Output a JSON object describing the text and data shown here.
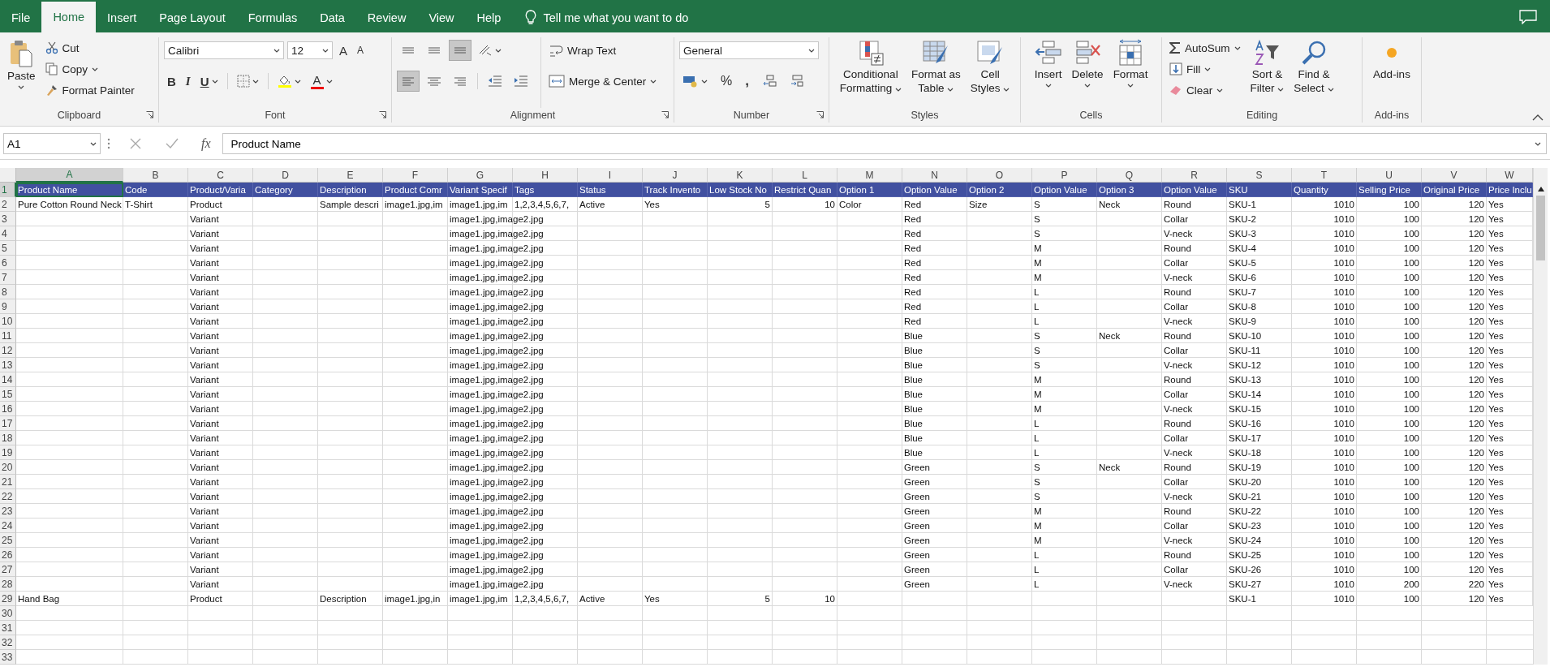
{
  "tabs": [
    {
      "label": "File",
      "selected": false
    },
    {
      "label": "Home",
      "selected": true
    },
    {
      "label": "Insert",
      "selected": false
    },
    {
      "label": "Page Layout",
      "selected": false
    },
    {
      "label": "Formulas",
      "selected": false
    },
    {
      "label": "Data",
      "selected": false
    },
    {
      "label": "Review",
      "selected": false
    },
    {
      "label": "View",
      "selected": false
    },
    {
      "label": "Help",
      "selected": false
    }
  ],
  "tell_me": "Tell me what you want to do",
  "ribbon": {
    "clipboard": {
      "label": "Clipboard",
      "paste": "Paste",
      "cut": "Cut",
      "copy": "Copy",
      "format_painter": "Format Painter"
    },
    "font": {
      "label": "Font",
      "name": "Calibri",
      "size": "12",
      "grow": "A",
      "shrink": "A",
      "bold": "B",
      "italic": "I",
      "underline": "U",
      "font_color": "A"
    },
    "alignment": {
      "label": "Alignment",
      "buttons": [
        {
          "kind": "top",
          "pressed": false
        },
        {
          "kind": "middle",
          "pressed": false
        },
        {
          "kind": "bottom",
          "pressed": true
        },
        {
          "kind": "left",
          "pressed": true
        },
        {
          "kind": "center",
          "pressed": false
        },
        {
          "kind": "right",
          "pressed": false
        }
      ],
      "wrap_text": "Wrap Text",
      "merge": "Merge & Center"
    },
    "number": {
      "label": "Number",
      "format": "General",
      "percent": "%",
      "comma": ","
    },
    "styles": {
      "label": "Styles",
      "buttons": [
        {
          "kind": "conditional",
          "lines": [
            "Conditional",
            "Formatting"
          ]
        },
        {
          "kind": "table",
          "lines": [
            "Format as",
            "Table"
          ]
        },
        {
          "kind": "cell",
          "lines": [
            "Cell",
            "Styles"
          ]
        }
      ]
    },
    "cells": {
      "label": "Cells",
      "buttons": [
        {
          "kind": "insert",
          "label": "Insert"
        },
        {
          "kind": "delete",
          "label": "Delete"
        },
        {
          "kind": "format",
          "label": "Format"
        }
      ]
    },
    "editing": {
      "label": "Editing",
      "autosum": "AutoSum",
      "fill": "Fill",
      "clear": "Clear",
      "sort": [
        "Sort &",
        "Filter"
      ],
      "find": [
        "Find &",
        "Select"
      ]
    },
    "addins": {
      "label": "Add-ins",
      "button": "Add-ins"
    }
  },
  "formula_bar": {
    "name_box": "A1",
    "fx": "fx",
    "value": "Product Name"
  },
  "columns": [
    {
      "letter": "A",
      "kind": "text",
      "selected": true
    },
    {
      "letter": "B",
      "kind": "text",
      "selected": false
    },
    {
      "letter": "C",
      "kind": "text",
      "selected": false
    },
    {
      "letter": "D",
      "selected": false
    },
    {
      "letter": "E",
      "kind": "text",
      "selected": false
    },
    {
      "letter": "F",
      "kind": "text",
      "selected": false
    },
    {
      "letter": "G",
      "kind": "text",
      "selected": false
    },
    {
      "letter": "H",
      "kind": "text",
      "selected": false
    },
    {
      "letter": "I",
      "kind": "text",
      "selected": false
    },
    {
      "letter": "J",
      "kind": "text",
      "selected": false
    },
    {
      "letter": "K",
      "kind": "number",
      "selected": false
    },
    {
      "letter": "L",
      "kind": "number",
      "selected": false
    },
    {
      "letter": "M",
      "kind": "text",
      "selected": false
    },
    {
      "letter": "N",
      "kind": "text",
      "selected": false
    },
    {
      "letter": "O",
      "kind": "text",
      "selected": false
    },
    {
      "letter": "P",
      "kind": "text",
      "selected": false
    },
    {
      "letter": "Q",
      "kind": "text",
      "selected": false
    },
    {
      "letter": "R",
      "kind": "text",
      "selected": false
    },
    {
      "letter": "S",
      "kind": "text",
      "selected": false
    },
    {
      "letter": "T",
      "kind": "number",
      "selected": false
    },
    {
      "letter": "U",
      "kind": "number",
      "selected": false
    },
    {
      "letter": "V",
      "kind": "number",
      "selected": false
    },
    {
      "letter": "W",
      "kind": "text",
      "selected": false
    }
  ],
  "header_row": {
    "n": "1",
    "selected": true,
    "cells": [
      "Product Name",
      "Code",
      "Product/Varia",
      "Category",
      "Description",
      "Product Comr",
      "Variant Specif",
      "Tags",
      "Status",
      "Track Invento",
      "Low Stock No",
      "Restrict Quan",
      "Option 1",
      "Option Value",
      "Option 2",
      "Option Value",
      "Option 3",
      "Option Value",
      "SKU",
      "Quantity",
      "Selling Price",
      "Original Price",
      "Price Inclu"
    ]
  },
  "rows": [
    {
      "n": "2",
      "selected": false,
      "cells": {
        "A": "Pure Cotton Round Neck",
        "B": "T-Shirt",
        "C": "Product",
        "E": "Sample descri",
        "F": "image1.jpg,im",
        "G": "image1.jpg,im",
        "H": "1,2,3,4,5,6,7,",
        "I": "Active",
        "J": "Yes",
        "K": "5",
        "L": "10",
        "M": "Color",
        "N": "Red",
        "O": "Size",
        "P": "S",
        "Q": "Neck",
        "R": "Round",
        "S": "SKU-1",
        "T": "1010",
        "U": "100",
        "V": "120",
        "W": "Yes"
      }
    },
    {
      "n": "3",
      "selected": false,
      "cells": {
        "C": "Variant",
        "G": "image1.jpg,image2.jpg",
        "N": "Red",
        "P": "S",
        "R": "Collar",
        "S": "SKU-2",
        "T": "1010",
        "U": "100",
        "V": "120",
        "W": "Yes"
      }
    },
    {
      "n": "4",
      "selected": false,
      "cells": {
        "C": "Variant",
        "G": "image1.jpg,image2.jpg",
        "N": "Red",
        "P": "S",
        "R": "V-neck",
        "S": "SKU-3",
        "T": "1010",
        "U": "100",
        "V": "120",
        "W": "Yes"
      }
    },
    {
      "n": "5",
      "selected": false,
      "cells": {
        "C": "Variant",
        "G": "image1.jpg,image2.jpg",
        "N": "Red",
        "P": "M",
        "R": "Round",
        "S": "SKU-4",
        "T": "1010",
        "U": "100",
        "V": "120",
        "W": "Yes"
      }
    },
    {
      "n": "6",
      "selected": false,
      "cells": {
        "C": "Variant",
        "G": "image1.jpg,image2.jpg",
        "N": "Red",
        "P": "M",
        "R": "Collar",
        "S": "SKU-5",
        "T": "1010",
        "U": "100",
        "V": "120",
        "W": "Yes"
      }
    },
    {
      "n": "7",
      "selected": false,
      "cells": {
        "C": "Variant",
        "G": "image1.jpg,image2.jpg",
        "N": "Red",
        "P": "M",
        "R": "V-neck",
        "S": "SKU-6",
        "T": "1010",
        "U": "100",
        "V": "120",
        "W": "Yes"
      }
    },
    {
      "n": "8",
      "selected": false,
      "cells": {
        "C": "Variant",
        "G": "image1.jpg,image2.jpg",
        "N": "Red",
        "P": "L",
        "R": "Round",
        "S": "SKU-7",
        "T": "1010",
        "U": "100",
        "V": "120",
        "W": "Yes"
      }
    },
    {
      "n": "9",
      "selected": false,
      "cells": {
        "C": "Variant",
        "G": "image1.jpg,image2.jpg",
        "N": "Red",
        "P": "L",
        "R": "Collar",
        "S": "SKU-8",
        "T": "1010",
        "U": "100",
        "V": "120",
        "W": "Yes"
      }
    },
    {
      "n": "10",
      "selected": false,
      "cells": {
        "C": "Variant",
        "G": "image1.jpg,image2.jpg",
        "N": "Red",
        "P": "L",
        "R": "V-neck",
        "S": "SKU-9",
        "T": "1010",
        "U": "100",
        "V": "120",
        "W": "Yes"
      }
    },
    {
      "n": "11",
      "selected": false,
      "cells": {
        "C": "Variant",
        "G": "image1.jpg,image2.jpg",
        "N": "Blue",
        "P": "S",
        "Q": "Neck",
        "R": "Round",
        "S": "SKU-10",
        "T": "1010",
        "U": "100",
        "V": "120",
        "W": "Yes"
      }
    },
    {
      "n": "12",
      "selected": false,
      "cells": {
        "C": "Variant",
        "G": "image1.jpg,image2.jpg",
        "N": "Blue",
        "P": "S",
        "R": "Collar",
        "S": "SKU-11",
        "T": "1010",
        "U": "100",
        "V": "120",
        "W": "Yes"
      }
    },
    {
      "n": "13",
      "selected": false,
      "cells": {
        "C": "Variant",
        "G": "image1.jpg,image2.jpg",
        "N": "Blue",
        "P": "S",
        "R": "V-neck",
        "S": "SKU-12",
        "T": "1010",
        "U": "100",
        "V": "120",
        "W": "Yes"
      }
    },
    {
      "n": "14",
      "selected": false,
      "cells": {
        "C": "Variant",
        "G": "image1.jpg,image2.jpg",
        "N": "Blue",
        "P": "M",
        "R": "Round",
        "S": "SKU-13",
        "T": "1010",
        "U": "100",
        "V": "120",
        "W": "Yes"
      }
    },
    {
      "n": "15",
      "selected": false,
      "cells": {
        "C": "Variant",
        "G": "image1.jpg,image2.jpg",
        "N": "Blue",
        "P": "M",
        "R": "Collar",
        "S": "SKU-14",
        "T": "1010",
        "U": "100",
        "V": "120",
        "W": "Yes"
      }
    },
    {
      "n": "16",
      "selected": false,
      "cells": {
        "C": "Variant",
        "G": "image1.jpg,image2.jpg",
        "N": "Blue",
        "P": "M",
        "R": "V-neck",
        "S": "SKU-15",
        "T": "1010",
        "U": "100",
        "V": "120",
        "W": "Yes"
      }
    },
    {
      "n": "17",
      "selected": false,
      "cells": {
        "C": "Variant",
        "G": "image1.jpg,image2.jpg",
        "N": "Blue",
        "P": "L",
        "R": "Round",
        "S": "SKU-16",
        "T": "1010",
        "U": "100",
        "V": "120",
        "W": "Yes"
      }
    },
    {
      "n": "18",
      "selected": false,
      "cells": {
        "C": "Variant",
        "G": "image1.jpg,image2.jpg",
        "N": "Blue",
        "P": "L",
        "R": "Collar",
        "S": "SKU-17",
        "T": "1010",
        "U": "100",
        "V": "120",
        "W": "Yes"
      }
    },
    {
      "n": "19",
      "selected": false,
      "cells": {
        "C": "Variant",
        "G": "image1.jpg,image2.jpg",
        "N": "Blue",
        "P": "L",
        "R": "V-neck",
        "S": "SKU-18",
        "T": "1010",
        "U": "100",
        "V": "120",
        "W": "Yes"
      }
    },
    {
      "n": "20",
      "selected": false,
      "cells": {
        "C": "Variant",
        "G": "image1.jpg,image2.jpg",
        "N": "Green",
        "P": "S",
        "Q": "Neck",
        "R": "Round",
        "S": "SKU-19",
        "T": "1010",
        "U": "100",
        "V": "120",
        "W": "Yes"
      }
    },
    {
      "n": "21",
      "selected": false,
      "cells": {
        "C": "Variant",
        "G": "image1.jpg,image2.jpg",
        "N": "Green",
        "P": "S",
        "R": "Collar",
        "S": "SKU-20",
        "T": "1010",
        "U": "100",
        "V": "120",
        "W": "Yes"
      }
    },
    {
      "n": "22",
      "selected": false,
      "cells": {
        "C": "Variant",
        "G": "image1.jpg,image2.jpg",
        "N": "Green",
        "P": "S",
        "R": "V-neck",
        "S": "SKU-21",
        "T": "1010",
        "U": "100",
        "V": "120",
        "W": "Yes"
      }
    },
    {
      "n": "23",
      "selected": false,
      "cells": {
        "C": "Variant",
        "G": "image1.jpg,image2.jpg",
        "N": "Green",
        "P": "M",
        "R": "Round",
        "S": "SKU-22",
        "T": "1010",
        "U": "100",
        "V": "120",
        "W": "Yes"
      }
    },
    {
      "n": "24",
      "selected": false,
      "cells": {
        "C": "Variant",
        "G": "image1.jpg,image2.jpg",
        "N": "Green",
        "P": "M",
        "R": "Collar",
        "S": "SKU-23",
        "T": "1010",
        "U": "100",
        "V": "120",
        "W": "Yes"
      }
    },
    {
      "n": "25",
      "selected": false,
      "cells": {
        "C": "Variant",
        "G": "image1.jpg,image2.jpg",
        "N": "Green",
        "P": "M",
        "R": "V-neck",
        "S": "SKU-24",
        "T": "1010",
        "U": "100",
        "V": "120",
        "W": "Yes"
      }
    },
    {
      "n": "26",
      "selected": false,
      "cells": {
        "C": "Variant",
        "G": "image1.jpg,image2.jpg",
        "N": "Green",
        "P": "L",
        "R": "Round",
        "S": "SKU-25",
        "T": "1010",
        "U": "100",
        "V": "120",
        "W": "Yes"
      }
    },
    {
      "n": "27",
      "selected": false,
      "cells": {
        "C": "Variant",
        "G": "image1.jpg,image2.jpg",
        "N": "Green",
        "P": "L",
        "R": "Collar",
        "S": "SKU-26",
        "T": "1010",
        "U": "100",
        "V": "120",
        "W": "Yes"
      }
    },
    {
      "n": "28",
      "selected": false,
      "cells": {
        "C": "Variant",
        "G": "image1.jpg,image2.jpg",
        "N": "Green",
        "P": "L",
        "R": "V-neck",
        "S": "SKU-27",
        "T": "1010",
        "U": "200",
        "V": "220",
        "W": "Yes"
      }
    },
    {
      "n": "29",
      "selected": false,
      "cells": {
        "A": "Hand Bag",
        "C": "Product",
        "E": "Description",
        "F": "image1.jpg,in",
        "G": "image1.jpg,im",
        "H": "1,2,3,4,5,6,7,",
        "I": "Active",
        "J": "Yes",
        "K": "5",
        "L": "10",
        "S": "SKU-1",
        "T": "1010",
        "U": "100",
        "V": "120",
        "W": "Yes"
      }
    },
    {
      "n": "30",
      "selected": false
    },
    {
      "n": "31",
      "selected": false
    },
    {
      "n": "32",
      "selected": false
    },
    {
      "n": "33",
      "selected": false
    }
  ]
}
